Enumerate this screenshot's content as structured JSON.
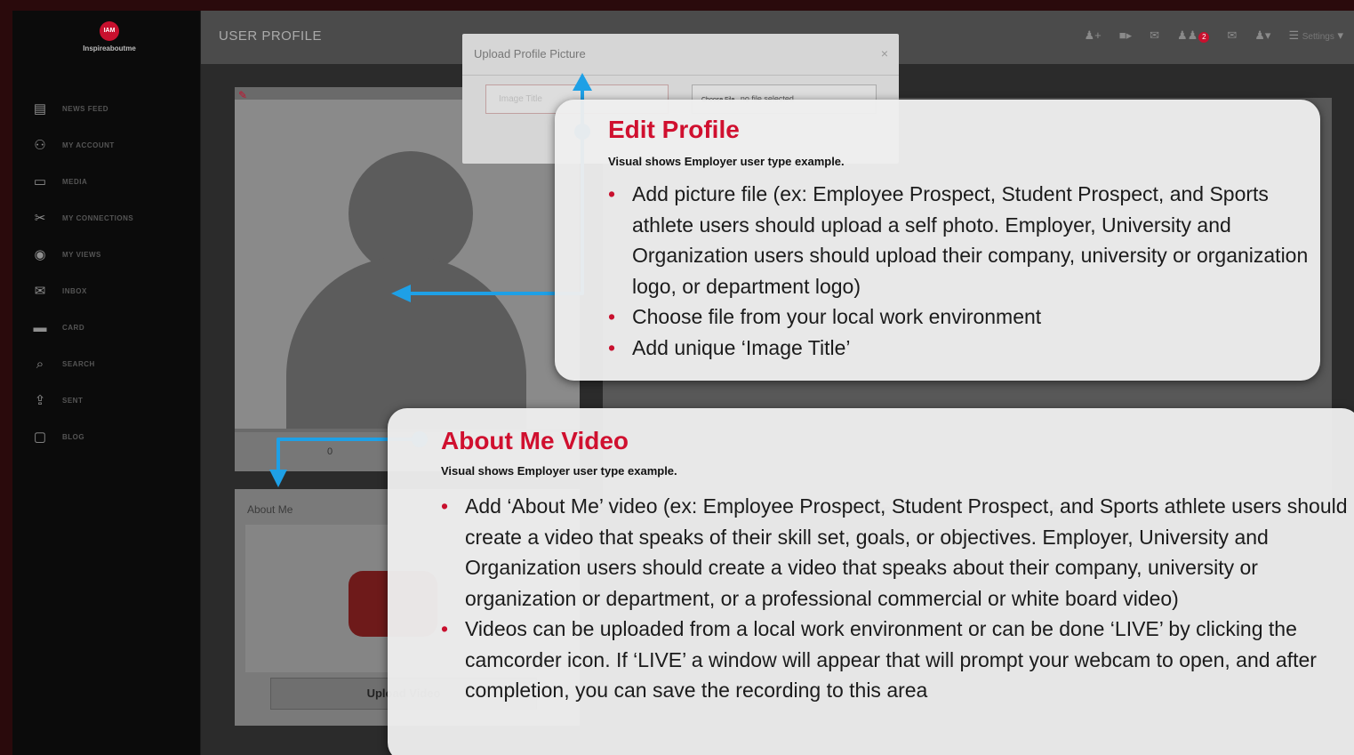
{
  "app": {
    "logo_text": "Inspireaboutme",
    "logo_mark": "IAM"
  },
  "sidebar": {
    "items": [
      {
        "label": "NEWS FEED",
        "icon": "news-feed-icon",
        "glyph": "▤"
      },
      {
        "label": "MY ACCOUNT",
        "icon": "account-icon",
        "glyph": "⚇"
      },
      {
        "label": "MEDIA",
        "icon": "media-icon",
        "glyph": "▭"
      },
      {
        "label": "MY CONNECTIONS",
        "icon": "connections-icon",
        "glyph": "✂"
      },
      {
        "label": "MY VIEWS",
        "icon": "eye-icon",
        "glyph": "◉"
      },
      {
        "label": "INBOX",
        "icon": "inbox-icon",
        "glyph": "✉"
      },
      {
        "label": "CARD",
        "icon": "card-icon",
        "glyph": "▬"
      },
      {
        "label": "SEARCH",
        "icon": "search-icon",
        "glyph": "⌕"
      },
      {
        "label": "SENT",
        "icon": "sent-icon",
        "glyph": "⇪"
      },
      {
        "label": "BLOG",
        "icon": "blog-icon",
        "glyph": "▢"
      }
    ]
  },
  "header": {
    "title": "USER PROFILE",
    "notification_count": "2",
    "settings_label": "Settings"
  },
  "profile": {
    "stat_value": "0",
    "about_title": "About Me",
    "upload_video_label": "Upload Video"
  },
  "modal": {
    "title": "Upload Profile Picture",
    "close": "×",
    "image_title_placeholder": "Image Title",
    "choose_file_label": "Choose File",
    "file_status": "no file selected"
  },
  "callouts": {
    "edit_profile": {
      "title": "Edit Profile",
      "subtitle": "Visual shows Employer user type example.",
      "bullets": [
        "Add picture file (ex: Employee Prospect, Student Prospect, and Sports athlete users should upload a self photo. Employer, University and Organization users should upload their company, university or organization logo, or department logo)",
        "Choose file from your local work environment",
        "Add unique ‘Image Title’"
      ]
    },
    "about_me_video": {
      "title": "About Me Video",
      "subtitle": "Visual shows Employer user type example.",
      "bullets": [
        "Add ‘About Me’ video (ex: Employee Prospect, Student Prospect, and Sports athlete users should create a video that speaks of their skill set, goals, or objectives. Employer, University and Organization users should create a video that speaks about their company, university or organization or department, or a professional commercial or white board video)",
        "Videos can be uploaded from a local work environment or can be done ‘LIVE’ by clicking the camcorder icon. If ‘LIVE’ a window will appear that will prompt your webcam to open, and after completion, you can save the recording to this area"
      ]
    }
  },
  "colors": {
    "accent_red": "#c8102e",
    "connector_blue": "#1ea0e6"
  }
}
